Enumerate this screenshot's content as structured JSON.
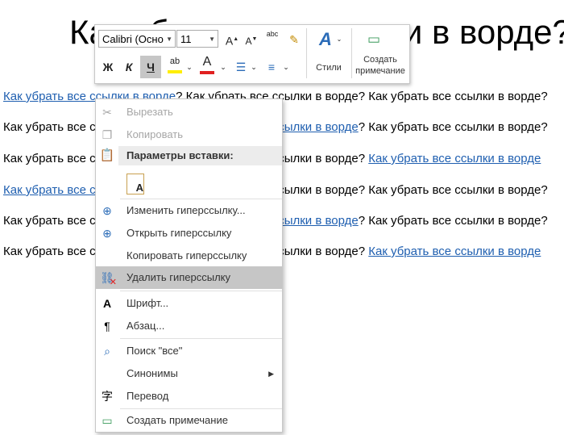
{
  "document": {
    "title": "Как убрать все ссылки в ворде?",
    "lines": [
      {
        "parts": [
          {
            "text": "Как убрать все ссылки в ворде",
            "link": true
          },
          {
            "text": "? Как убрать все ссылки в ворде? Как убрать все ссылки в ворде?",
            "link": false
          }
        ]
      },
      {
        "parts": [
          {
            "text": "Как убрать все ссылки в ворде? Как убрать все ",
            "link": false
          },
          {
            "text": "ссылки в ворде",
            "link": true
          },
          {
            "text": "? Как убрать все ссылки в ворде?",
            "link": false
          }
        ]
      },
      {
        "parts": [
          {
            "text": "Как убрать все ссылки в ворде? Как убрать все ссылки в ворде? ",
            "link": false
          },
          {
            "text": "Как убрать все ссылки в ворде",
            "link": true
          }
        ]
      },
      {
        "parts": [
          {
            "text": "Как убрать все ссылки",
            "link": true
          },
          {
            "text": " в ворде? Как убрать все ссылки в ворде? Как убрать все ссылки в ворде?",
            "link": false
          }
        ]
      },
      {
        "parts": [
          {
            "text": "Как убрать все ссылки в ворде? Как убрать все ",
            "link": false
          },
          {
            "text": "ссылки в ворде",
            "link": true
          },
          {
            "text": "? Как убрать все ссылки в ворде?",
            "link": false
          }
        ]
      },
      {
        "parts": [
          {
            "text": "Как убрать все ссылки в ворде? Как убрать все ссылки в ворде? ",
            "link": false
          },
          {
            "text": "Как убрать все ссылки в ворде",
            "link": true
          }
        ]
      }
    ]
  },
  "toolbar": {
    "font_name": "Calibri (Осно",
    "font_size": "11",
    "grow_font": "A",
    "shrink_font": "A",
    "clear_format": "abc",
    "bold": "Ж",
    "italic": "К",
    "underline": "Ч",
    "highlight": "ab",
    "font_color": "A",
    "styles_label": "Стили",
    "comment_label_line1": "Создать",
    "comment_label_line2": "примечание"
  },
  "menu": {
    "cut": "Вырезать",
    "copy": "Копировать",
    "paste_header": "Параметры вставки:",
    "edit_link": "Изменить гиперссылку...",
    "open_link": "Открыть гиперссылку",
    "copy_link": "Копировать гиперссылку",
    "remove_link": "Удалить гиперссылку",
    "font": "Шрифт...",
    "paragraph": "Абзац...",
    "search": "Поиск \"все\"",
    "synonyms": "Синонимы",
    "translate": "Перевод",
    "new_comment": "Создать примечание"
  },
  "colors": {
    "link": "#1f5fb0",
    "highlight": "#ffee00",
    "font_color": "#e02020",
    "hover": "#c6c6c6",
    "icon_blue": "#2b6cb8"
  }
}
